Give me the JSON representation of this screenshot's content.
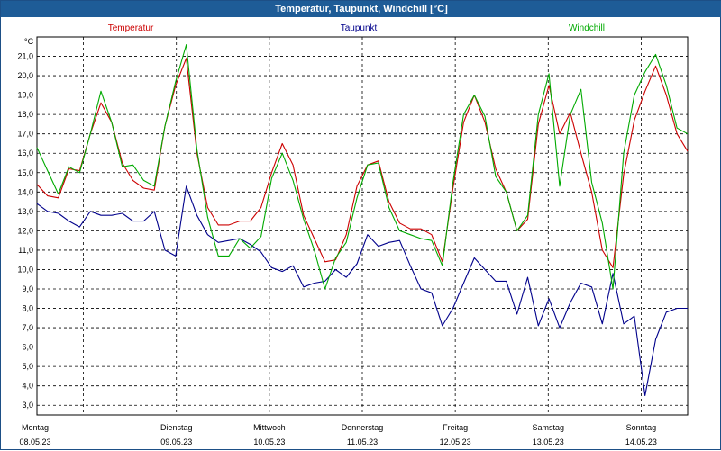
{
  "window": {
    "title": "Temperatur, Taupunkt, Windchill [°C]"
  },
  "chart_data": {
    "type": "line",
    "title": "Temperatur, Taupunkt, Windchill [°C]",
    "ylabel": "°C",
    "ylim": [
      2.5,
      22.0
    ],
    "y_ticks": [
      "3,0",
      "4,0",
      "5,0",
      "6,0",
      "7,0",
      "8,0",
      "9,0",
      "10,0",
      "11,0",
      "12,0",
      "13,0",
      "14,0",
      "15,0",
      "16,0",
      "17,0",
      "18,0",
      "19,0",
      "20,0",
      "21,0"
    ],
    "x_range_days": [
      0,
      7
    ],
    "x_ticks": [
      {
        "day": "Montag",
        "date": "08.05.23"
      },
      {
        "day": "Dienstag",
        "date": "09.05.23"
      },
      {
        "day": "Mittwoch",
        "date": "10.05.23"
      },
      {
        "day": "Donnerstag",
        "date": "11.05.23"
      },
      {
        "day": "Freitag",
        "date": "12.05.23"
      },
      {
        "day": "Samstag",
        "date": "13.05.23"
      },
      {
        "day": "Sonntag",
        "date": "14.05.23"
      }
    ],
    "grid": true,
    "legend_position": "top",
    "x": [
      0.0,
      0.125,
      0.25,
      0.375,
      0.5,
      0.625,
      0.75,
      0.875,
      1.0,
      1.125,
      1.25,
      1.375,
      1.5,
      1.625,
      1.75,
      1.875,
      2.0,
      2.125,
      2.25,
      2.375,
      2.5,
      2.625,
      2.75,
      2.875,
      3.0,
      3.125,
      3.25,
      3.375,
      3.5,
      3.625,
      3.75,
      3.875,
      4.0,
      4.125,
      4.25,
      4.375,
      4.5,
      4.625,
      4.75,
      4.875,
      5.0,
      5.125,
      5.25,
      5.375,
      5.5,
      5.625,
      5.75,
      5.875,
      6.0,
      6.125,
      6.25,
      6.375,
      6.5,
      6.625,
      6.75,
      6.875,
      7.0
    ],
    "series": [
      {
        "name": "Temperatur",
        "color": "#cc0000",
        "values": [
          14.4,
          13.8,
          13.7,
          15.2,
          15.1,
          17.0,
          18.6,
          17.6,
          15.5,
          14.6,
          14.2,
          14.1,
          17.4,
          19.5,
          20.9,
          16.0,
          13.2,
          12.3,
          12.3,
          12.5,
          12.5,
          13.2,
          15.0,
          16.5,
          15.4,
          12.8,
          11.6,
          10.4,
          10.5,
          11.8,
          14.3,
          15.4,
          15.6,
          13.5,
          12.4,
          12.1,
          12.1,
          11.8,
          10.4,
          14.2,
          17.6,
          19.0,
          17.6,
          15.2,
          14.0,
          12.0,
          12.6,
          17.5,
          19.5,
          17.0,
          18.1,
          16.0,
          14.0,
          11.0,
          10.1,
          14.9,
          17.7,
          19.2,
          20.5,
          19.0,
          17.0,
          16.1
        ]
      },
      {
        "name": "Taupunkt",
        "color": "#00008b",
        "values": [
          13.4,
          13.0,
          12.9,
          12.5,
          12.2,
          13.0,
          12.8,
          12.8,
          12.9,
          12.5,
          12.5,
          13.0,
          11.0,
          10.7,
          14.3,
          12.8,
          11.8,
          11.4,
          11.5,
          11.6,
          11.3,
          10.9,
          10.1,
          9.9,
          10.2,
          9.1,
          9.3,
          9.4,
          10.0,
          9.6,
          10.3,
          11.8,
          11.2,
          11.4,
          11.5,
          10.2,
          9.0,
          8.8,
          7.1,
          8.0,
          9.3,
          10.6,
          10.0,
          9.4,
          9.4,
          7.7,
          9.6,
          7.1,
          8.5,
          7.0,
          8.3,
          9.3,
          9.1,
          7.2,
          9.8,
          7.2,
          7.6,
          3.5,
          6.4,
          7.8,
          8.0,
          8.0
        ]
      },
      {
        "name": "Windchill",
        "color": "#00aa00",
        "values": [
          16.3,
          15.1,
          13.9,
          15.3,
          15.0,
          17.0,
          19.2,
          17.6,
          15.3,
          15.4,
          14.6,
          14.3,
          17.4,
          19.7,
          21.6,
          16.2,
          12.7,
          10.7,
          10.7,
          11.6,
          11.1,
          11.7,
          14.7,
          16.0,
          14.6,
          12.6,
          11.0,
          9.0,
          10.6,
          11.4,
          13.7,
          15.4,
          15.5,
          13.2,
          12.0,
          11.8,
          11.6,
          11.5,
          10.2,
          14.5,
          18.0,
          19.0,
          17.9,
          14.8,
          14.0,
          12.0,
          12.8,
          18.0,
          20.1,
          14.3,
          18.0,
          19.3,
          14.5,
          12.4,
          9.0,
          16.0,
          19.0,
          20.2,
          21.1,
          19.5,
          17.3,
          17.0
        ]
      }
    ]
  }
}
